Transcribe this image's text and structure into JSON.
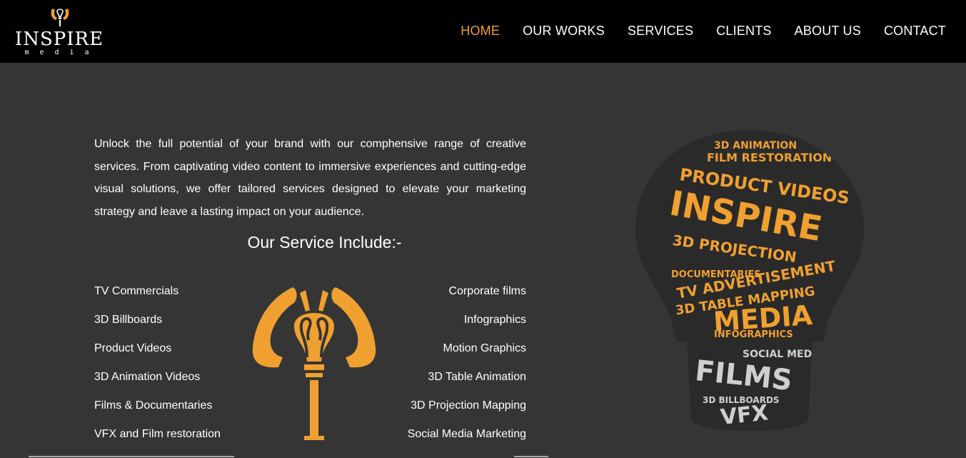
{
  "header": {
    "logo_word": "INSPIRE",
    "logo_sub": "media",
    "nav": [
      "HOME",
      "OUR WORKS",
      "SERVICES",
      "CLIENTS",
      "ABOUT US",
      "CONTACT"
    ],
    "active_nav": "HOME",
    "accent_color": "#f0a030"
  },
  "main": {
    "intro": "Unlock the full potential of your brand with our comphensive range of creative services. From captivating video content to immersive experiences and cutting-edge visual solutions, we offer tailored services designed to elevate your marketing strategy and leave a lasting impact on your audience.",
    "heading": "Our Service Include:-",
    "services_left": [
      "TV Commercials",
      "3D Billboards",
      "Product Videos",
      "3D Animation Videos",
      "Films & Documentaries",
      "VFX and Film restoration"
    ],
    "services_right": [
      "Corporate films",
      "Infographics",
      "Motion Graphics",
      "3D Table Animation",
      "3D Projection Mapping",
      "Social Media Marketing"
    ]
  },
  "bulb_words": {
    "big": [
      "INSPIRE",
      "MEDIA",
      "FILMS",
      "VFX"
    ],
    "medium": [
      "PRODUCT VIDEOS",
      "3D ANIMATION",
      "FILM RESTORATION",
      "3D PROJECTION",
      "TV ADVERTISEMENT",
      "3D TABLE MAPPING",
      "INFOGRAPHICS",
      "DOCUMENTARIES",
      "SOCIAL MEDIA",
      "3D BILLBOARDS"
    ]
  }
}
